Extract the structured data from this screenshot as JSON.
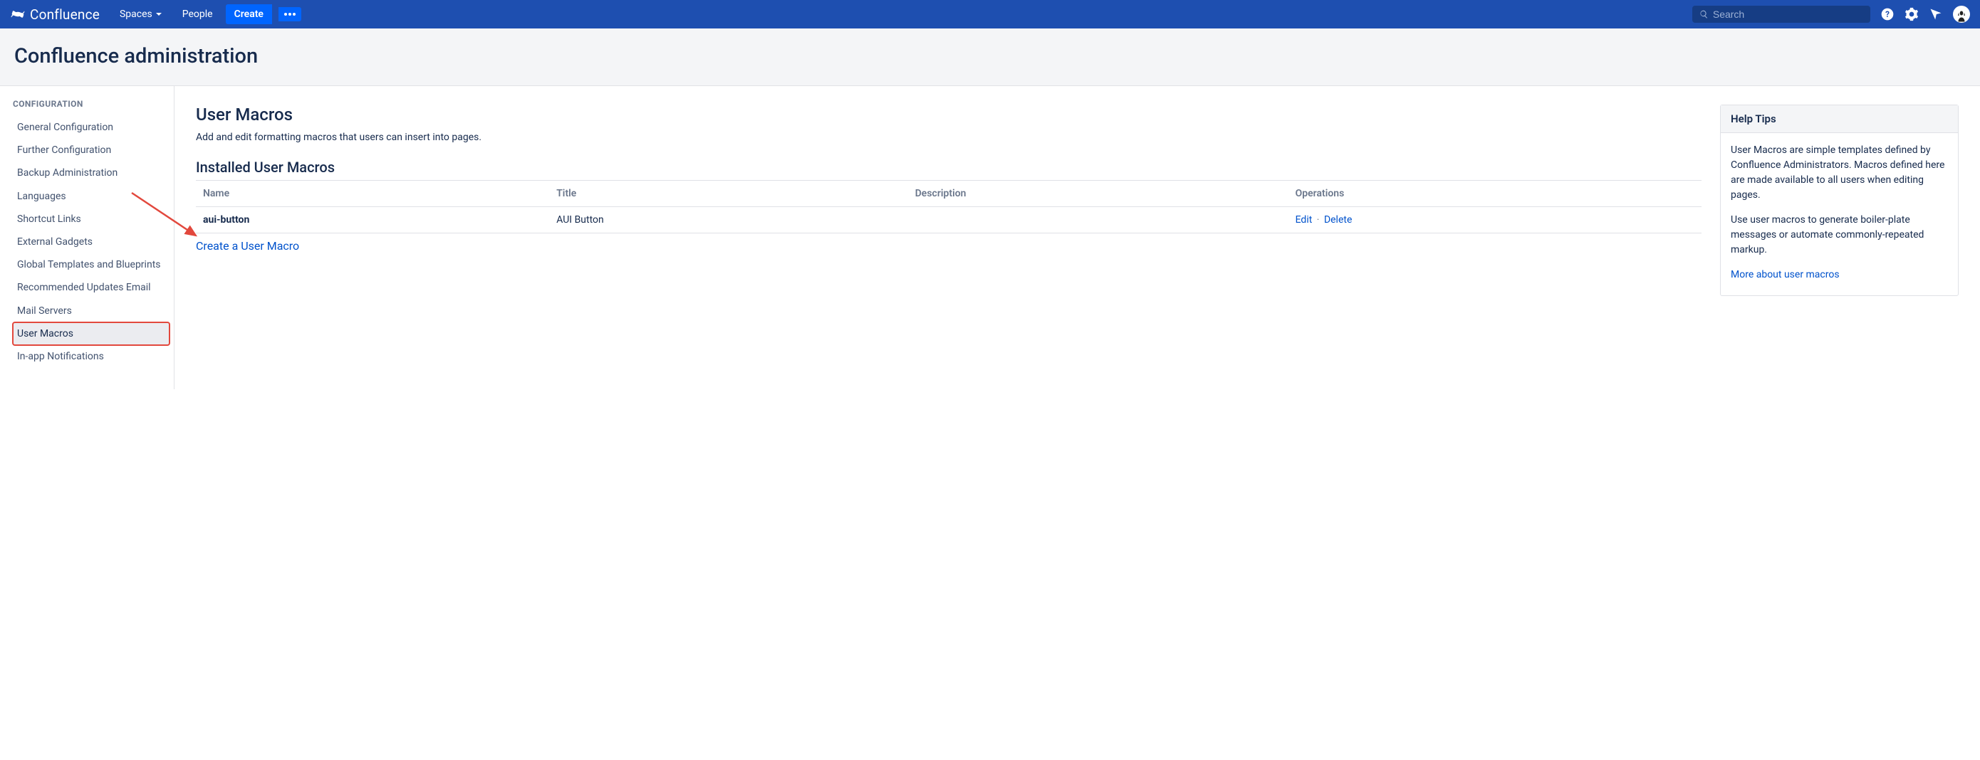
{
  "nav": {
    "product": "Confluence",
    "spaces": "Spaces",
    "people": "People",
    "create": "Create",
    "search_placeholder": "Search"
  },
  "page": {
    "title": "Confluence administration"
  },
  "sidebar": {
    "heading": "CONFIGURATION",
    "items": [
      "General Configuration",
      "Further Configuration",
      "Backup Administration",
      "Languages",
      "Shortcut Links",
      "External Gadgets",
      "Global Templates and Blueprints",
      "Recommended Updates Email",
      "Mail Servers",
      "User Macros",
      "In-app Notifications"
    ],
    "active_index": 9
  },
  "main": {
    "heading": "User Macros",
    "description": "Add and edit formatting macros that users can insert into pages.",
    "section_heading": "Installed User Macros",
    "columns": [
      "Name",
      "Title",
      "Description",
      "Operations"
    ],
    "rows": [
      {
        "name": "aui-button",
        "title": "AUI Button",
        "description": ""
      }
    ],
    "ops": {
      "edit": "Edit",
      "delete": "Delete"
    },
    "create_link": "Create a User Macro"
  },
  "help": {
    "heading": "Help Tips",
    "p1": "User Macros are simple templates defined by Confluence Administrators. Macros defined here are made available to all users when editing pages.",
    "p2": "Use user macros to generate boiler-plate messages or automate commonly-repeated markup.",
    "more": "More about user macros"
  }
}
